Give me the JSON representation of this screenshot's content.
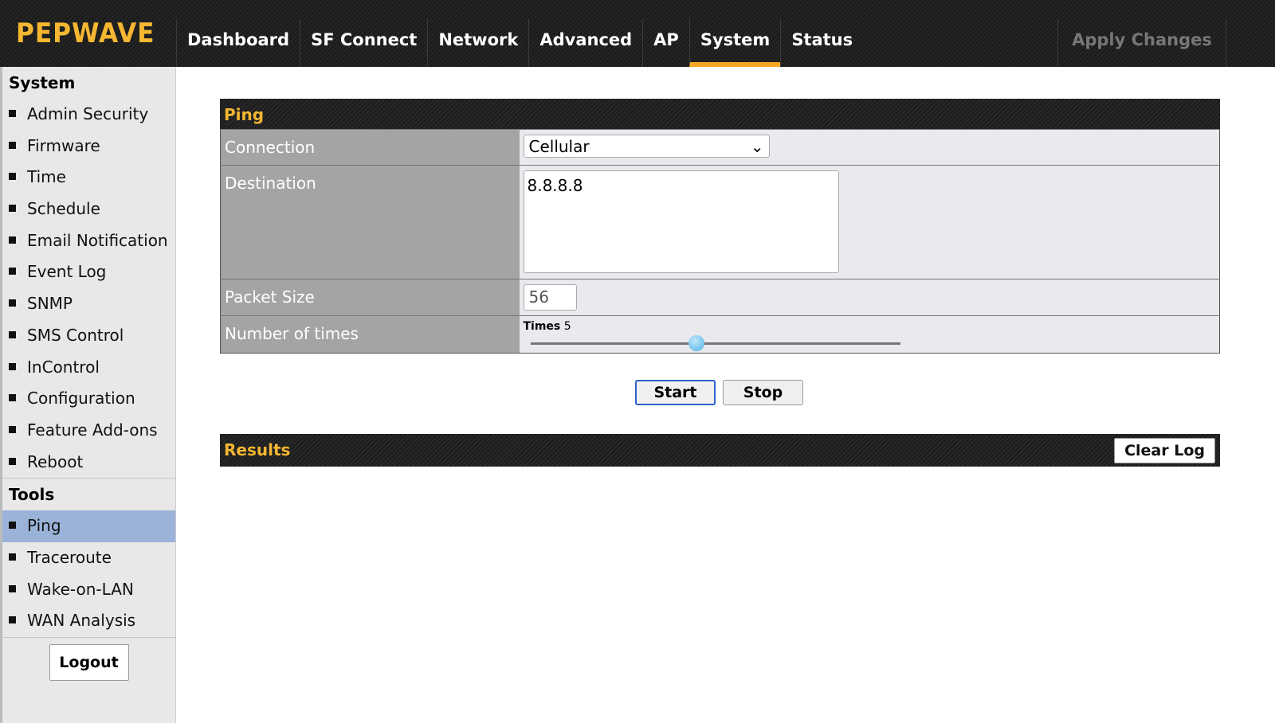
{
  "header": {
    "logo": "PEPWAVE",
    "nav": [
      "Dashboard",
      "SF Connect",
      "Network",
      "Advanced",
      "AP",
      "System",
      "Status"
    ],
    "active": "System",
    "apply": "Apply Changes"
  },
  "sidebar": {
    "system_heading": "System",
    "system_items": [
      "Admin Security",
      "Firmware",
      "Time",
      "Schedule",
      "Email Notification",
      "Event Log",
      "SNMP",
      "SMS Control",
      "InControl",
      "Configuration",
      "Feature Add-ons",
      "Reboot"
    ],
    "tools_heading": "Tools",
    "tools_items": [
      "Ping",
      "Traceroute",
      "Wake-on-LAN",
      "WAN Analysis"
    ],
    "active": "Ping",
    "logout": "Logout"
  },
  "ping": {
    "title": "Ping",
    "connection_label": "Connection",
    "connection_value": "Cellular",
    "destination_label": "Destination",
    "destination_value": "8.8.8.8",
    "packet_size_label": "Packet Size",
    "packet_size_value": "56",
    "times_label": "Number of times",
    "times_caption": "Times",
    "times_value": "5",
    "times_slider_percent": 45,
    "start": "Start",
    "stop": "Stop"
  },
  "results": {
    "title": "Results",
    "clear_log": "Clear Log"
  },
  "colors": {
    "accent": "#f5b731",
    "active_sidebar": "#9bb3d9",
    "primary_button_border": "#2a62c9"
  }
}
